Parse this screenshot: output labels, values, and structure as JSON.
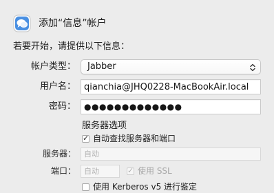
{
  "header": {
    "icon": "messages-icon",
    "title": "添加“信息”帐户"
  },
  "subtitle": "若要开始，请提供以下信息：",
  "form": {
    "account_type": {
      "label": "帐户类型：",
      "value": "Jabber"
    },
    "username": {
      "label": "用户名：",
      "value": "qianchia@JHQ0228-MacBookAir.local"
    },
    "password": {
      "label": "密码：",
      "value": "●●●●●●●●●●●●●"
    },
    "server_options": {
      "title": "服务器选项",
      "auto_find": {
        "label": "自动查找服务器和端口",
        "checked": true
      },
      "server": {
        "label": "服务器：",
        "placeholder": "自动"
      },
      "port": {
        "label": "端口：",
        "placeholder": "自动"
      },
      "use_ssl": {
        "label": "使用 SSL",
        "checked": true,
        "enabled": false
      },
      "kerberos": {
        "label": "使用 Kerberos v5 进行鉴定",
        "checked": false
      }
    }
  }
}
